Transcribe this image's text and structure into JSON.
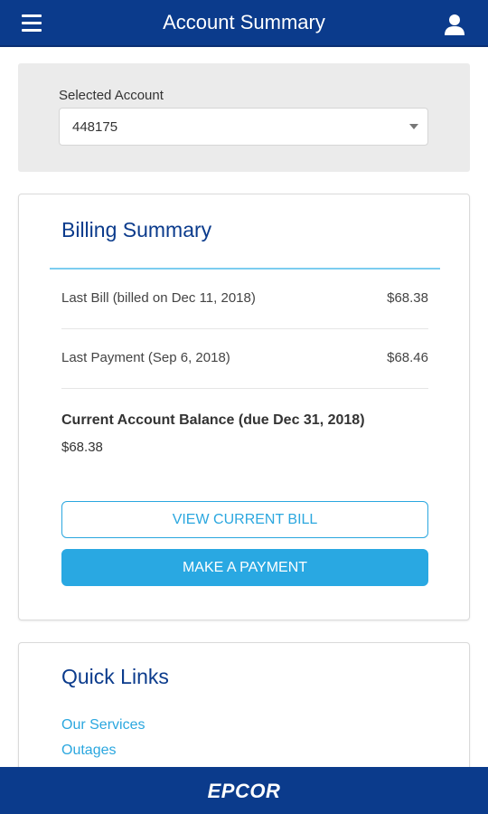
{
  "header": {
    "title": "Account Summary",
    "menu_icon": "hamburger-menu-icon",
    "user_icon": "user-profile-icon",
    "background_color": "#0b3b8c"
  },
  "account_selector": {
    "label": "Selected Account",
    "selected_value": "448175"
  },
  "billing_summary": {
    "title": "Billing Summary",
    "rows": [
      {
        "label": "Last Bill (billed on Dec 11, 2018)",
        "amount": "$68.38"
      },
      {
        "label": "Last Payment (Sep 6, 2018)",
        "amount": "$68.46"
      }
    ],
    "balance_label": "Current Account Balance (due Dec 31, 2018)",
    "balance_amount": "$68.38",
    "view_bill_label": "VIEW CURRENT BILL",
    "make_payment_label": "MAKE A PAYMENT",
    "accent_color": "#29a8e2"
  },
  "quick_links": {
    "title": "Quick Links",
    "links": [
      "Our Services",
      "Outages"
    ]
  },
  "footer": {
    "logo_text": "EPCOR"
  }
}
